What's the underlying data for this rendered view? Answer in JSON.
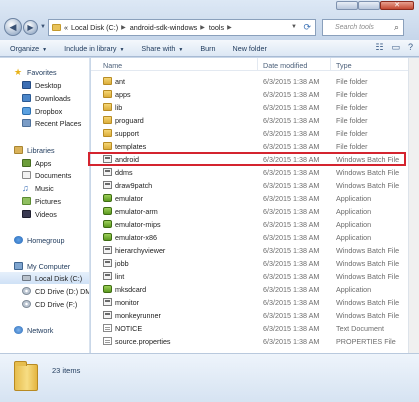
{
  "address": {
    "crumbs": [
      "Local Disk (C:)",
      "android-sdk-windows",
      "tools"
    ],
    "prefix": "«"
  },
  "search": {
    "placeholder": "Search tools"
  },
  "toolbar": {
    "organize": "Organize",
    "include": "Include in library",
    "share": "Share with",
    "burn": "Burn",
    "new_folder": "New folder"
  },
  "nav": {
    "favorites": "Favorites",
    "desktop": "Desktop",
    "downloads": "Downloads",
    "dropbox": "Dropbox",
    "recent": "Recent Places",
    "libraries": "Libraries",
    "apps": "Apps",
    "documents": "Documents",
    "music": "Music",
    "pictures": "Pictures",
    "videos": "Videos",
    "homegroup": "Homegroup",
    "computer": "My Computer",
    "local_disk": "Local Disk (C:)",
    "cd_d": "CD Drive (D:) DM",
    "cd_f": "CD Drive (F:)",
    "network": "Network"
  },
  "columns": {
    "name": "Name",
    "date": "Date modified",
    "type": "Type"
  },
  "files": [
    {
      "name": "ant",
      "date": "6/3/2015 1:38 AM",
      "type": "File folder",
      "icon": "folder"
    },
    {
      "name": "apps",
      "date": "6/3/2015 1:38 AM",
      "type": "File folder",
      "icon": "folder"
    },
    {
      "name": "lib",
      "date": "6/3/2015 1:38 AM",
      "type": "File folder",
      "icon": "folder"
    },
    {
      "name": "proguard",
      "date": "6/3/2015 1:38 AM",
      "type": "File folder",
      "icon": "folder"
    },
    {
      "name": "support",
      "date": "6/3/2015 1:38 AM",
      "type": "File folder",
      "icon": "folder"
    },
    {
      "name": "templates",
      "date": "6/3/2015 1:38 AM",
      "type": "File folder",
      "icon": "folder"
    },
    {
      "name": "android",
      "date": "6/3/2015 1:38 AM",
      "type": "Windows Batch File",
      "icon": "batch"
    },
    {
      "name": "ddms",
      "date": "6/3/2015 1:38 AM",
      "type": "Windows Batch File",
      "icon": "batch"
    },
    {
      "name": "draw9patch",
      "date": "6/3/2015 1:38 AM",
      "type": "Windows Batch File",
      "icon": "batch"
    },
    {
      "name": "emulator",
      "date": "6/3/2015 1:38 AM",
      "type": "Application",
      "icon": "app"
    },
    {
      "name": "emulator-arm",
      "date": "6/3/2015 1:38 AM",
      "type": "Application",
      "icon": "app"
    },
    {
      "name": "emulator-mips",
      "date": "6/3/2015 1:38 AM",
      "type": "Application",
      "icon": "app"
    },
    {
      "name": "emulator-x86",
      "date": "6/3/2015 1:38 AM",
      "type": "Application",
      "icon": "app"
    },
    {
      "name": "hierarchyviewer",
      "date": "6/3/2015 1:38 AM",
      "type": "Windows Batch File",
      "icon": "batch"
    },
    {
      "name": "jobb",
      "date": "6/3/2015 1:38 AM",
      "type": "Windows Batch File",
      "icon": "batch"
    },
    {
      "name": "lint",
      "date": "6/3/2015 1:38 AM",
      "type": "Windows Batch File",
      "icon": "batch"
    },
    {
      "name": "mksdcard",
      "date": "6/3/2015 1:38 AM",
      "type": "Application",
      "icon": "app"
    },
    {
      "name": "monitor",
      "date": "6/3/2015 1:38 AM",
      "type": "Windows Batch File",
      "icon": "batch"
    },
    {
      "name": "monkeyrunner",
      "date": "6/3/2015 1:38 AM",
      "type": "Windows Batch File",
      "icon": "batch"
    },
    {
      "name": "NOTICE",
      "date": "6/3/2015 1:38 AM",
      "type": "Text Document",
      "icon": "text"
    },
    {
      "name": "source.properties",
      "date": "6/3/2015 1:38 AM",
      "type": "PROPERTIES File",
      "icon": "text"
    }
  ],
  "highlighted_file": "android",
  "status": {
    "item_count": "23 items"
  },
  "colors": {
    "highlight": "#d4242f",
    "selection": "#cfe1f6"
  }
}
